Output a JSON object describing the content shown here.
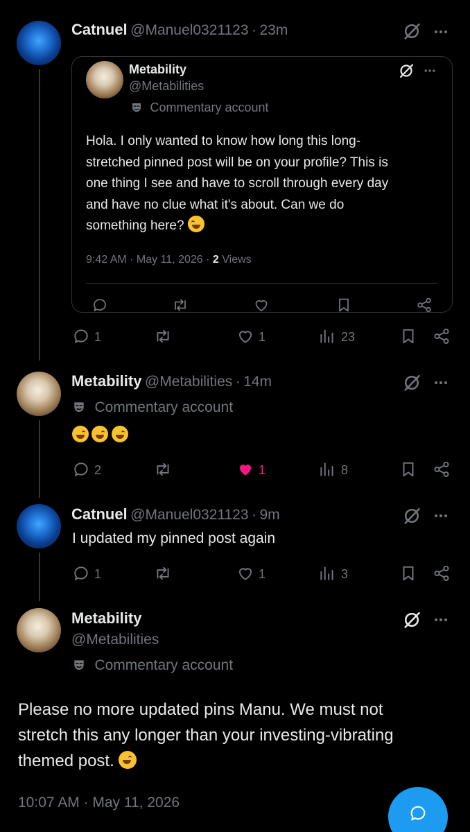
{
  "colors": {
    "background": "#000000",
    "text": "#e7e9ea",
    "muted": "#71767b",
    "like_active": "#f91880",
    "accent": "#1d9bf0"
  },
  "post1": {
    "name": "Catnuel",
    "handle": "@Manuel0321123",
    "sep": "·",
    "time": "23m",
    "quote": {
      "name": "Metability",
      "handle": "@Metabilities",
      "badge": "Commentary account",
      "lines": [
        "Hola. I only wanted to know how long this long-",
        "stretched pinned post will be on your profile? This is",
        "one thing I see and have to scroll through every day",
        "and have no clue what it's about. Can we do",
        "something here?"
      ],
      "time": "9:42 AM · May 11, 2026 ·",
      "views_count": "2",
      "views_label": "Views"
    },
    "replies": "1",
    "likes": "1",
    "views": "23"
  },
  "post2": {
    "name": "Metability",
    "handle": "@Metabilities",
    "sep": "·",
    "time": "14m",
    "badge": "Commentary account",
    "replies": "2",
    "likes": "1",
    "views": "8"
  },
  "post3": {
    "name": "Catnuel",
    "handle": "@Manuel0321123",
    "sep": "·",
    "time": "9m",
    "text": "I updated my pinned post again",
    "replies": "1",
    "likes": "1",
    "views": "3"
  },
  "post4": {
    "name": "Metability",
    "handle": "@Metabilities",
    "badge": "Commentary account",
    "lines": [
      "Please no more updated pins Manu. We must not",
      "stretch this any longer than your investing-vibrating",
      "themed post."
    ],
    "timestamp": "10:07 AM · May 11, 2026"
  }
}
